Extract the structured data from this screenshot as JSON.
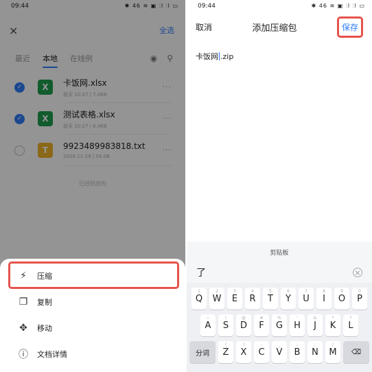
{
  "left": {
    "status_time": "09:44",
    "status_icons": "✱ 46 ≋ ▣ ⫶l ⫶l ▭",
    "close_glyph": "×",
    "select_all": "全选",
    "tabs": [
      {
        "label": "最近"
      },
      {
        "label": "本地"
      },
      {
        "label": "在线例"
      }
    ],
    "files": [
      {
        "name": "卡饭网.xlsx",
        "meta": "前天 10:27  |  7.0KB",
        "type_glyph": "X",
        "checked_glyph": "✓"
      },
      {
        "name": "测试表格.xlsx",
        "meta": "前天 10:27  |  6.4KB",
        "type_glyph": "X",
        "checked_glyph": "✓"
      },
      {
        "name": "9923489983818.txt",
        "meta": "2020-11-28  |  56.0B",
        "type_glyph": "T",
        "checked_glyph": ""
      }
    ],
    "more_glyph": "···",
    "end_note": "已经到底啦",
    "sheet": {
      "items": [
        {
          "label": "压缩",
          "icon": "compress-icon",
          "glyph": "⚡"
        },
        {
          "label": "复制",
          "icon": "copy-icon",
          "glyph": "❐"
        },
        {
          "label": "移动",
          "icon": "move-icon",
          "glyph": "✥"
        },
        {
          "label": "文档详情",
          "icon": "info-icon",
          "glyph": "ⓘ"
        }
      ]
    }
  },
  "right": {
    "status_time": "09:44",
    "status_icons": "✱ 46 ≋ ▣ ⫶l ⫶l ▭",
    "cancel": "取消",
    "title": "添加压缩包",
    "save": "保存",
    "filename_before": "卡饭网",
    "filename_after": ".zip",
    "keyboard": {
      "clipboard": "剪贴板",
      "candidate": "了",
      "delete_glyph": "×",
      "row1": [
        {
          "sub": "1",
          "k": "Q"
        },
        {
          "sub": "2",
          "k": "W"
        },
        {
          "sub": "3",
          "k": "E"
        },
        {
          "sub": "4",
          "k": "R"
        },
        {
          "sub": "5",
          "k": "T"
        },
        {
          "sub": "6",
          "k": "Y"
        },
        {
          "sub": "7",
          "k": "U"
        },
        {
          "sub": "8",
          "k": "I"
        },
        {
          "sub": "9",
          "k": "O"
        },
        {
          "sub": "0",
          "k": "P"
        }
      ],
      "row2": [
        {
          "sub": "~",
          "k": "A"
        },
        {
          "sub": "!",
          "k": "S"
        },
        {
          "sub": "@",
          "k": "D"
        },
        {
          "sub": "#",
          "k": "F"
        },
        {
          "sub": "%",
          "k": "G"
        },
        {
          "sub": "'",
          "k": "H"
        },
        {
          "sub": "&",
          "k": "J"
        },
        {
          "sub": "*",
          "k": "K"
        },
        {
          "sub": "?",
          "k": "L"
        }
      ],
      "row3_left": "分词",
      "row3": [
        {
          "sub": "(",
          "k": "Z"
        },
        {
          "sub": ")",
          "k": "X"
        },
        {
          "sub": "-",
          "k": "C"
        },
        {
          "sub": "_",
          "k": "V"
        },
        {
          "sub": ":",
          "k": "B"
        },
        {
          "sub": ";",
          "k": "N"
        },
        {
          "sub": "/",
          "k": "M"
        }
      ],
      "row3_right_glyph": "⌫"
    }
  }
}
